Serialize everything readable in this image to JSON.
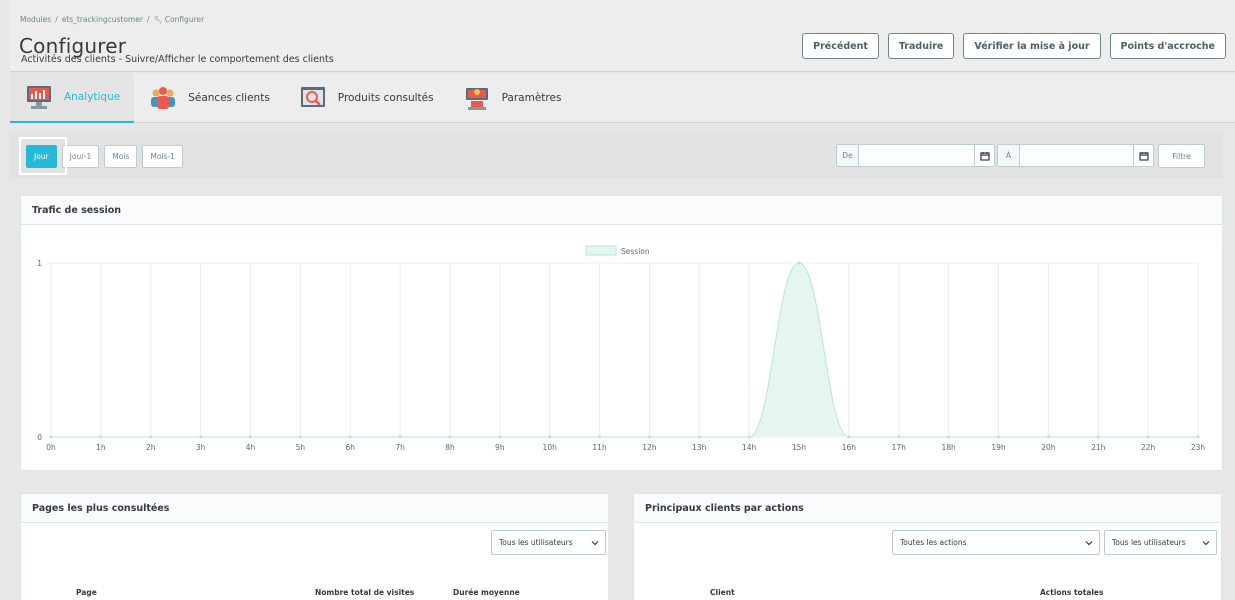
{
  "breadcrumb": [
    "Modules",
    "ets_trackingcustomer",
    "Configurer"
  ],
  "title": "Configurer",
  "subtitle": "Activités des clients - Suivre/Afficher le comportement des clients",
  "toolbar": [
    "Précédent",
    "Traduire",
    "Vérifier la mise à jour",
    "Points d'accroche"
  ],
  "tabs": [
    {
      "label": "Analytique",
      "icon": "analytics-monitor-icon",
      "active": true
    },
    {
      "label": "Séances clients",
      "icon": "customers-group-icon",
      "active": false
    },
    {
      "label": "Produits consultés",
      "icon": "product-search-icon",
      "active": false
    },
    {
      "label": "Paramètres",
      "icon": "settings-desk-icon",
      "active": false
    }
  ],
  "period_buttons": [
    {
      "label": "Jour",
      "active": true
    },
    {
      "label": "Jour-1",
      "active": false
    },
    {
      "label": "Mois",
      "active": false
    },
    {
      "label": "Mois-1",
      "active": false
    }
  ],
  "date_from": {
    "label": "De",
    "value": ""
  },
  "date_to": {
    "label": "À",
    "value": ""
  },
  "filter_label": "Filtre",
  "chart_panel_title": "Trafic de session",
  "chart_data": {
    "type": "area",
    "title": "",
    "x": [
      "0h",
      "1h",
      "2h",
      "3h",
      "4h",
      "5h",
      "6h",
      "7h",
      "8h",
      "9h",
      "10h",
      "11h",
      "12h",
      "13h",
      "14h",
      "15h",
      "16h",
      "17h",
      "18h",
      "19h",
      "20h",
      "21h",
      "22h",
      "23h"
    ],
    "series": [
      {
        "name": "Session",
        "values": [
          0,
          0,
          0,
          0,
          0,
          0,
          0,
          0,
          0,
          0,
          0,
          0,
          0,
          0,
          0,
          1,
          0,
          0,
          0,
          0,
          0,
          0,
          0,
          0
        ]
      }
    ],
    "yticks": [
      "0",
      "1"
    ],
    "ylim": [
      0,
      1
    ],
    "grid": true,
    "legend": "top-center",
    "fill_color": "#e5f6f1",
    "line_color": "#b8e4d6"
  },
  "bottom_left": {
    "title": "Pages les plus consultées",
    "select": "Tous les utilisateurs",
    "columns": [
      "Page",
      "Nombre total de visites",
      "Durée moyenne"
    ]
  },
  "bottom_right": {
    "title": "Principaux clients par actions",
    "select_actions": "Toutes les actions",
    "select_users": "Tous les utilisateurs",
    "columns": [
      "Client",
      "Actions totales"
    ]
  },
  "colors": {
    "accent": "#25b9d7",
    "muted": "#6c868e"
  }
}
